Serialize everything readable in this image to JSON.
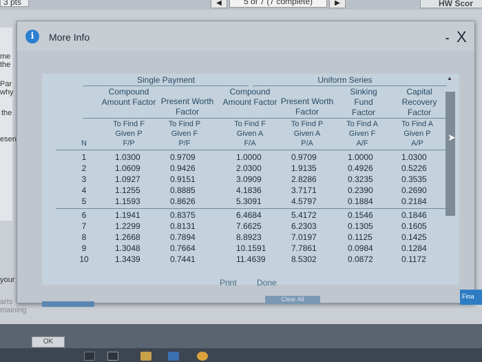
{
  "top": {
    "pts": "3 pts",
    "prev_icon": "left-arrow",
    "progress": "5 of 7 (7 complete)",
    "next_icon": "right-arrow",
    "hw_score": "HW Scor"
  },
  "bg_labels": [
    "me",
    "the",
    "Par",
    "why",
    "the",
    "esen",
    "your ans",
    "arts",
    "maining"
  ],
  "modal": {
    "title": "More Info",
    "info_icon": "i",
    "minimize": "-",
    "close": "X"
  },
  "groups": {
    "single": "Single Payment",
    "uniform": "Uniform Series"
  },
  "headers": [
    {
      "name": "Compound Amount Factor",
      "find": "To Find F Given P",
      "notation": "F/P"
    },
    {
      "name": "Present Worth Factor",
      "find": "To Find P Given F",
      "notation": "P/F"
    },
    {
      "name": "Compound Amount Factor",
      "find": "To Find F Given A",
      "notation": "F/A"
    },
    {
      "name": "Present Worth Factor",
      "find": "To Find P Given A",
      "notation": "P/A"
    },
    {
      "name": "Sinking Fund Factor",
      "find": "To Find A Given F",
      "notation": "A/F"
    },
    {
      "name": "Capital Recovery Factor",
      "find": "To Find A Given P",
      "notation": "A/P"
    }
  ],
  "n_label": "N",
  "rows": [
    [
      "1",
      "1.0300",
      "0.9709",
      "1.0000",
      "0.9709",
      "1.0000",
      "1.0300"
    ],
    [
      "2",
      "1.0609",
      "0.9426",
      "2.0300",
      "1.9135",
      "0.4926",
      "0.5226"
    ],
    [
      "3",
      "1.0927",
      "0.9151",
      "3.0909",
      "2.8286",
      "0.3235",
      "0.3535"
    ],
    [
      "4",
      "1.1255",
      "0.8885",
      "4.1836",
      "3.7171",
      "0.2390",
      "0.2690"
    ],
    [
      "5",
      "1.1593",
      "0.8626",
      "5.3091",
      "4.5797",
      "0.1884",
      "0.2184"
    ],
    [
      "6",
      "1.1941",
      "0.8375",
      "6.4684",
      "5.4172",
      "0.1546",
      "0.1846"
    ],
    [
      "7",
      "1.2299",
      "0.8131",
      "7.6625",
      "6.2303",
      "0.1305",
      "0.1605"
    ],
    [
      "8",
      "1.2668",
      "0.7894",
      "8.8923",
      "7.0197",
      "0.1125",
      "0.1425"
    ],
    [
      "9",
      "1.3048",
      "0.7664",
      "10.1591",
      "7.7861",
      "0.0984",
      "0.1284"
    ],
    [
      "10",
      "1.3439",
      "0.7441",
      "11.4639",
      "8.5302",
      "0.0872",
      "0.1172"
    ]
  ],
  "buttons": {
    "print": "Print",
    "done": "Done",
    "clear_all": "Clear All",
    "final": "Fina",
    "ok": "OK"
  },
  "colors": {
    "info": "#2c7fd1",
    "table_bg": "#c3d2dc",
    "header_text": "#2a4a66"
  }
}
